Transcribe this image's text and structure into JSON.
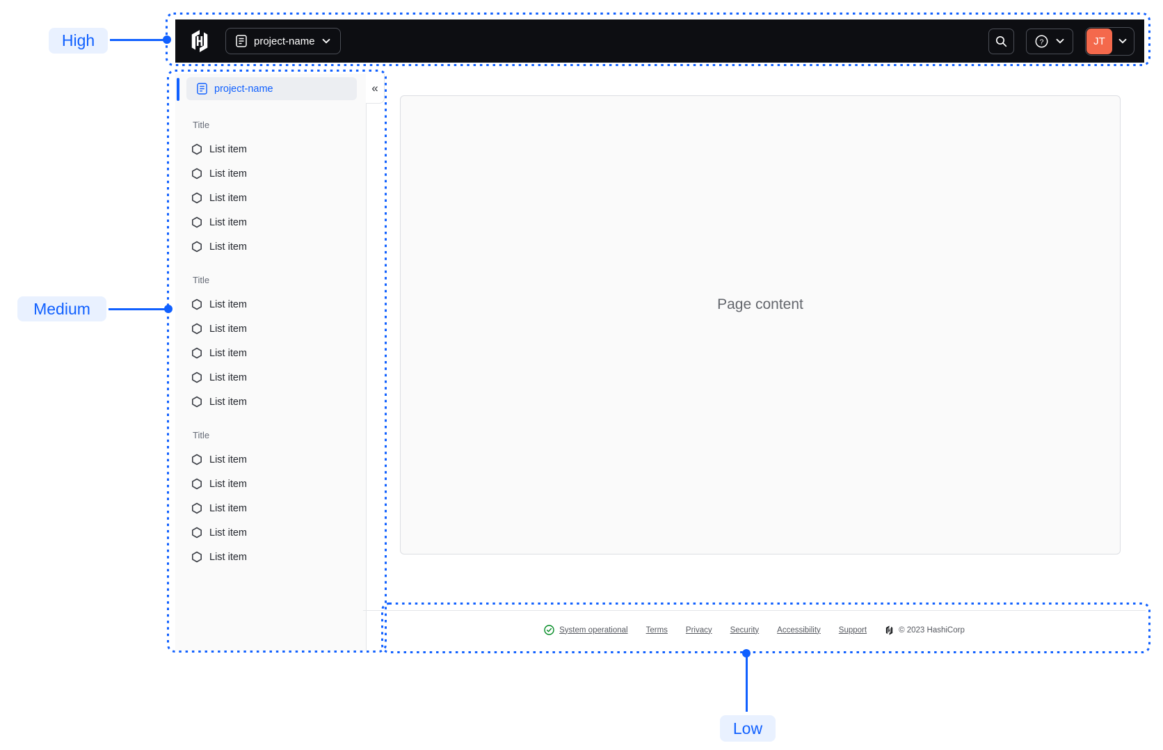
{
  "annotations": {
    "high": "High",
    "medium": "Medium",
    "low": "Low"
  },
  "navbar": {
    "project_switcher": "project-name",
    "avatar_initials": "JT"
  },
  "sidebar": {
    "header": {
      "label": "project-name",
      "collapse_icon": "«"
    },
    "sections": [
      {
        "title": "Title",
        "items": [
          "List item",
          "List item",
          "List item",
          "List item",
          "List item"
        ]
      },
      {
        "title": "Title",
        "items": [
          "List item",
          "List item",
          "List item",
          "List item",
          "List item"
        ]
      },
      {
        "title": "Title",
        "items": [
          "List item",
          "List item",
          "List item",
          "List item",
          "List item"
        ]
      }
    ]
  },
  "main": {
    "placeholder": "Page content"
  },
  "footer": {
    "status": "System operational",
    "links": [
      "Terms",
      "Privacy",
      "Security",
      "Accessibility",
      "Support"
    ],
    "copyright": "© 2023 HashiCorp"
  },
  "icons": {
    "hashicorp_logo": "hexagon-H brand mark",
    "document": "page with text lines",
    "hexagon": "outlined hexagon bullet",
    "search": "magnifier",
    "help": "question mark in circle",
    "chevron_down": "v",
    "check_circle": "check in circle"
  },
  "colors": {
    "accent_blue": "#1060ff",
    "accent_blue_bg": "#e9f1ff",
    "avatar_orange": "#f4694c",
    "status_green": "#008a22",
    "navbar_black": "#0d0e12"
  }
}
